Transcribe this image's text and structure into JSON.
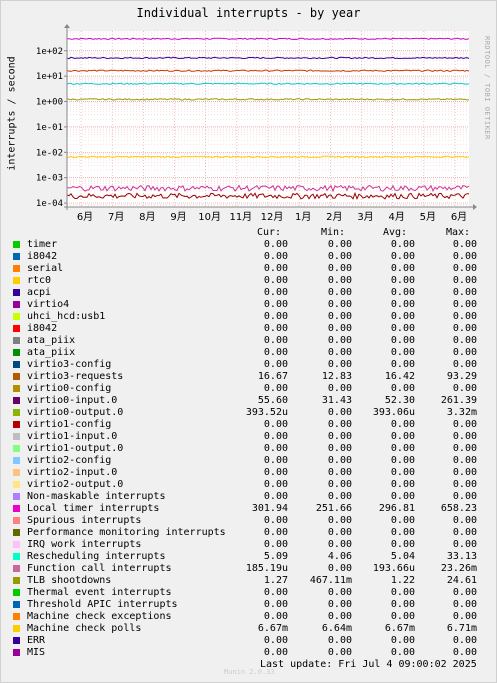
{
  "title": "Individual interrupts - by year",
  "ylabel": "interrupts / second",
  "watermark": "RRDTOOL / TOBI OETIKER",
  "headers": {
    "cur": "Cur:",
    "min": "Min:",
    "avg": "Avg:",
    "max": "Max:"
  },
  "footer": "Last update: Fri Jul  4 09:00:02 2025",
  "munin": "Munin 2.0.33",
  "chart_data": {
    "type": "line",
    "title": "Individual interrupts - by year",
    "ylabel": "interrupts / second",
    "yscale": "log",
    "ylim": [
      7e-05,
      600
    ],
    "ytick_labels": [
      "1e+02",
      "1e+01",
      "1e+00",
      "1e-01",
      "1e-02",
      "1e-03",
      "1e-04"
    ],
    "yticks": [
      100,
      10,
      1,
      0.1,
      0.01,
      0.001,
      0.0001
    ],
    "xtick_labels": [
      "6月",
      "7月",
      "8月",
      "9月",
      "10月",
      "11月",
      "12月",
      "1月",
      "2月",
      "3月",
      "4月",
      "5月",
      "6月"
    ],
    "grid": true,
    "series": [
      {
        "name": "Local timer interrupts",
        "color": "#cc00cc",
        "value": 296.81
      },
      {
        "name": "virtio0-input.0",
        "color": "#330099",
        "value": 52.3
      },
      {
        "name": "virtio3-requests",
        "color": "#cc3300",
        "value": 16.42
      },
      {
        "name": "Rescheduling interrupts",
        "color": "#00cccc",
        "value": 5.04
      },
      {
        "name": "TLB shootdowns",
        "color": "#999900",
        "value": 1.22
      },
      {
        "name": "Machine check polls",
        "color": "#ffcc00",
        "value": 0.00667
      },
      {
        "name": "Function call interrupts",
        "color": "#990000",
        "value": 0.000194
      },
      {
        "name": "virtio0-output.0",
        "color": "#cc3399",
        "value": 0.000393
      }
    ]
  },
  "legend": [
    {
      "name": "timer",
      "color": "#00cc00",
      "cur": "0.00",
      "min": "0.00",
      "avg": "0.00",
      "max": "0.00"
    },
    {
      "name": "i8042",
      "color": "#0066b3",
      "cur": "0.00",
      "min": "0.00",
      "avg": "0.00",
      "max": "0.00"
    },
    {
      "name": "serial",
      "color": "#ff8000",
      "cur": "0.00",
      "min": "0.00",
      "avg": "0.00",
      "max": "0.00"
    },
    {
      "name": "rtc0",
      "color": "#ffcc00",
      "cur": "0.00",
      "min": "0.00",
      "avg": "0.00",
      "max": "0.00"
    },
    {
      "name": "acpi",
      "color": "#330099",
      "cur": "0.00",
      "min": "0.00",
      "avg": "0.00",
      "max": "0.00"
    },
    {
      "name": "virtio4",
      "color": "#990099",
      "cur": "0.00",
      "min": "0.00",
      "avg": "0.00",
      "max": "0.00"
    },
    {
      "name": "uhci_hcd:usb1",
      "color": "#ccff00",
      "cur": "0.00",
      "min": "0.00",
      "avg": "0.00",
      "max": "0.00"
    },
    {
      "name": "i8042",
      "color": "#ff0000",
      "cur": "0.00",
      "min": "0.00",
      "avg": "0.00",
      "max": "0.00"
    },
    {
      "name": "ata_piix",
      "color": "#808080",
      "cur": "0.00",
      "min": "0.00",
      "avg": "0.00",
      "max": "0.00"
    },
    {
      "name": "ata_piix",
      "color": "#008f00",
      "cur": "0.00",
      "min": "0.00",
      "avg": "0.00",
      "max": "0.00"
    },
    {
      "name": "virtio3-config",
      "color": "#00487d",
      "cur": "0.00",
      "min": "0.00",
      "avg": "0.00",
      "max": "0.00"
    },
    {
      "name": "virtio3-requests",
      "color": "#b35a00",
      "cur": "16.67",
      "min": "12.83",
      "avg": "16.42",
      "max": "93.29"
    },
    {
      "name": "virtio0-config",
      "color": "#b38f00",
      "cur": "0.00",
      "min": "0.00",
      "avg": "0.00",
      "max": "0.00"
    },
    {
      "name": "virtio0-input.0",
      "color": "#6b006b",
      "cur": "55.60",
      "min": "31.43",
      "avg": "52.30",
      "max": "261.39"
    },
    {
      "name": "virtio0-output.0",
      "color": "#8fb300",
      "cur": "393.52u",
      "min": "0.00",
      "avg": "393.06u",
      "max": "3.32m"
    },
    {
      "name": "virtio1-config",
      "color": "#b30000",
      "cur": "0.00",
      "min": "0.00",
      "avg": "0.00",
      "max": "0.00"
    },
    {
      "name": "virtio1-input.0",
      "color": "#bebebe",
      "cur": "0.00",
      "min": "0.00",
      "avg": "0.00",
      "max": "0.00"
    },
    {
      "name": "virtio1-output.0",
      "color": "#80ff80",
      "cur": "0.00",
      "min": "0.00",
      "avg": "0.00",
      "max": "0.00"
    },
    {
      "name": "virtio2-config",
      "color": "#80c9ff",
      "cur": "0.00",
      "min": "0.00",
      "avg": "0.00",
      "max": "0.00"
    },
    {
      "name": "virtio2-input.0",
      "color": "#ffc080",
      "cur": "0.00",
      "min": "0.00",
      "avg": "0.00",
      "max": "0.00"
    },
    {
      "name": "virtio2-output.0",
      "color": "#ffe680",
      "cur": "0.00",
      "min": "0.00",
      "avg": "0.00",
      "max": "0.00"
    },
    {
      "name": "Non-maskable interrupts",
      "color": "#aa80ff",
      "cur": "0.00",
      "min": "0.00",
      "avg": "0.00",
      "max": "0.00"
    },
    {
      "name": "Local timer interrupts",
      "color": "#ee00cc",
      "cur": "301.94",
      "min": "251.66",
      "avg": "296.81",
      "max": "658.23"
    },
    {
      "name": "Spurious interrupts",
      "color": "#ff8080",
      "cur": "0.00",
      "min": "0.00",
      "avg": "0.00",
      "max": "0.00"
    },
    {
      "name": "Performance monitoring interrupts",
      "color": "#666600",
      "cur": "0.00",
      "min": "0.00",
      "avg": "0.00",
      "max": "0.00"
    },
    {
      "name": "IRQ work interrupts",
      "color": "#ffbfff",
      "cur": "0.00",
      "min": "0.00",
      "avg": "0.00",
      "max": "0.00"
    },
    {
      "name": "Rescheduling interrupts",
      "color": "#00ffcc",
      "cur": "5.09",
      "min": "4.06",
      "avg": "5.04",
      "max": "33.13"
    },
    {
      "name": "Function call interrupts",
      "color": "#cc6699",
      "cur": "185.19u",
      "min": "0.00",
      "avg": "193.66u",
      "max": "23.26m"
    },
    {
      "name": "TLB shootdowns",
      "color": "#999900",
      "cur": "1.27",
      "min": "467.11m",
      "avg": "1.22",
      "max": "24.61"
    },
    {
      "name": "Thermal event interrupts",
      "color": "#00cc00",
      "cur": "0.00",
      "min": "0.00",
      "avg": "0.00",
      "max": "0.00"
    },
    {
      "name": "Threshold APIC interrupts",
      "color": "#0066b3",
      "cur": "0.00",
      "min": "0.00",
      "avg": "0.00",
      "max": "0.00"
    },
    {
      "name": "Machine check exceptions",
      "color": "#ff8000",
      "cur": "0.00",
      "min": "0.00",
      "avg": "0.00",
      "max": "0.00"
    },
    {
      "name": "Machine check polls",
      "color": "#ffcc00",
      "cur": "6.67m",
      "min": "6.64m",
      "avg": "6.67m",
      "max": "6.71m"
    },
    {
      "name": "ERR",
      "color": "#330099",
      "cur": "0.00",
      "min": "0.00",
      "avg": "0.00",
      "max": "0.00"
    },
    {
      "name": "MIS",
      "color": "#990099",
      "cur": "0.00",
      "min": "0.00",
      "avg": "0.00",
      "max": "0.00"
    }
  ]
}
